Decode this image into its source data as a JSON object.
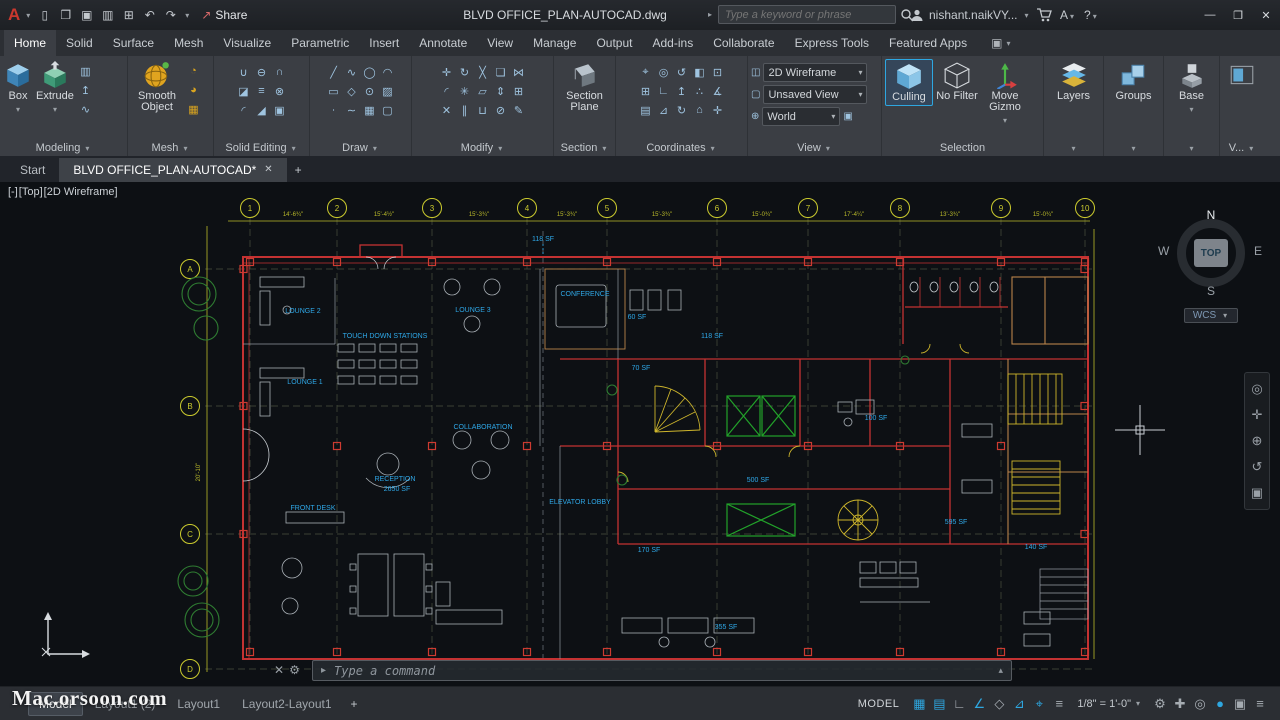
{
  "titlebar": {
    "logo": "A",
    "quick_icons": [
      {
        "name": "new-file",
        "glyph": "▯"
      },
      {
        "name": "open-file",
        "glyph": "❐"
      },
      {
        "name": "save",
        "glyph": "▣"
      },
      {
        "name": "save-as",
        "glyph": "▥"
      },
      {
        "name": "plot",
        "glyph": "⊞"
      },
      {
        "name": "undo",
        "glyph": "↶"
      },
      {
        "name": "redo",
        "glyph": "↷"
      }
    ],
    "share_label": "Share",
    "doc_title": "BLVD OFFICE_PLAN-AUTOCAD.dwg",
    "search_placeholder": "Type a keyword or phrase",
    "user_name": "nishant.naikVY...",
    "app_menu": "A",
    "help": "?"
  },
  "ribbon": {
    "tabs": [
      "Home",
      "Solid",
      "Surface",
      "Mesh",
      "Visualize",
      "Parametric",
      "Insert",
      "Annotate",
      "View",
      "Manage",
      "Output",
      "Add-ins",
      "Collaborate",
      "Express Tools",
      "Featured Apps"
    ],
    "panels": {
      "modeling": {
        "label": "Modeling",
        "box": "Box",
        "extrude": "Extrude",
        "icons": [
          {
            "name": "polysolid",
            "glyph": "▥"
          },
          {
            "name": "presspull",
            "glyph": "↥"
          },
          {
            "name": "sweep",
            "glyph": "∿"
          }
        ]
      },
      "mesh": {
        "label": "Mesh",
        "smooth_object": "Smooth Object",
        "icons": [
          {
            "name": "smooth-more",
            "glyph": "◔"
          },
          {
            "name": "smooth-less",
            "glyph": "◕"
          },
          {
            "name": "refine-mesh",
            "glyph": "▦"
          }
        ]
      },
      "solid_editing": {
        "label": "Solid Editing",
        "r1": [
          {
            "name": "union",
            "glyph": "∪"
          },
          {
            "name": "subtract",
            "glyph": "⊖"
          },
          {
            "name": "intersect",
            "glyph": "∩"
          }
        ],
        "r2": [
          {
            "name": "slice",
            "glyph": "◪"
          },
          {
            "name": "thicken",
            "glyph": "≡"
          },
          {
            "name": "interfere",
            "glyph": "⊗"
          }
        ],
        "r3": [
          {
            "name": "fillet-edge",
            "glyph": "◜"
          },
          {
            "name": "taper-face",
            "glyph": "◢"
          },
          {
            "name": "shell",
            "glyph": "▣"
          }
        ]
      },
      "draw": {
        "label": "Draw",
        "r1": [
          {
            "name": "line",
            "glyph": "╱"
          },
          {
            "name": "polyline",
            "glyph": "∿"
          },
          {
            "name": "circle",
            "glyph": "◯"
          },
          {
            "name": "arc",
            "glyph": "◠"
          }
        ],
        "r2": [
          {
            "name": "rectangle",
            "glyph": "▭"
          },
          {
            "name": "polygon",
            "glyph": "◇"
          },
          {
            "name": "ellipse",
            "glyph": "⊙"
          },
          {
            "name": "hatch",
            "glyph": "▨"
          }
        ],
        "r3": [
          {
            "name": "point",
            "glyph": "∙"
          },
          {
            "name": "spline",
            "glyph": "∼"
          },
          {
            "name": "gradient",
            "glyph": "▦"
          },
          {
            "name": "region",
            "glyph": "▢"
          }
        ]
      },
      "modify": {
        "label": "Modify",
        "r1": [
          {
            "name": "move",
            "glyph": "✛"
          },
          {
            "name": "rotate",
            "glyph": "↻"
          },
          {
            "name": "trim",
            "glyph": "╳"
          },
          {
            "name": "copy",
            "glyph": "❏"
          },
          {
            "name": "mirror",
            "glyph": "⋈"
          }
        ],
        "r2": [
          {
            "name": "fillet",
            "glyph": "◜"
          },
          {
            "name": "explode",
            "glyph": "✳"
          },
          {
            "name": "stretch",
            "glyph": "▱"
          },
          {
            "name": "scale",
            "glyph": "⇕"
          },
          {
            "name": "array",
            "glyph": "⊞"
          }
        ],
        "r3": [
          {
            "name": "erase",
            "glyph": "✕"
          },
          {
            "name": "offset",
            "glyph": "∥"
          },
          {
            "name": "join",
            "glyph": "⊔"
          },
          {
            "name": "measure",
            "glyph": "⊘"
          },
          {
            "name": "edit-polyline",
            "glyph": "✎"
          }
        ]
      },
      "section": {
        "label": "Section",
        "section_plane": "Section Plane"
      },
      "coordinates": {
        "label": "Coordinates",
        "r1": [
          {
            "name": "ucs",
            "glyph": "⌖"
          },
          {
            "name": "ucs-world",
            "glyph": "◎"
          },
          {
            "name": "ucs-previous",
            "glyph": "↺"
          },
          {
            "name": "ucs-face",
            "glyph": "◧"
          },
          {
            "name": "ucs-object",
            "glyph": "⊡"
          }
        ],
        "r2": [
          {
            "name": "ucs-view",
            "glyph": "⊞"
          },
          {
            "name": "ucs-origin",
            "glyph": "∟"
          },
          {
            "name": "ucs-z-axis",
            "glyph": "↥"
          },
          {
            "name": "ucs-3-point",
            "glyph": "∴"
          },
          {
            "name": "ucs-rotate-x",
            "glyph": "∡"
          }
        ],
        "r3": [
          {
            "name": "named-ucs",
            "glyph": "▤"
          },
          {
            "name": "ucs-rotate-y",
            "glyph": "⊿"
          },
          {
            "name": "ucs-rotate-z",
            "glyph": "↻"
          },
          {
            "name": "ucs-icon-properties",
            "glyph": "⌂"
          },
          {
            "name": "show-ucs-icon",
            "glyph": "✛"
          }
        ]
      },
      "view": {
        "label": "View",
        "visual_style": "2D Wireframe",
        "named_view": "Unsaved View",
        "ucs_name": "World"
      },
      "selection": {
        "label": "Selection",
        "culling": "Culling",
        "no_filter": "No Filter",
        "move_gizmo": "Move Gizmo"
      },
      "layers": {
        "label": "Layers"
      },
      "groups": {
        "label": "Groups"
      },
      "base": {
        "label": "Base"
      },
      "more": {
        "label": "V..."
      }
    }
  },
  "filetabs": {
    "start": "Start",
    "active_doc": "BLVD OFFICE_PLAN-AUTOCAD*"
  },
  "viewport": {
    "controls": {
      "minimize": "[-]",
      "view": "[Top]",
      "visual_style": "[2D Wireframe]"
    },
    "viewcube": {
      "north": "N",
      "south": "S",
      "east": "E",
      "west": "W",
      "top": "TOP",
      "wcs": "WCS"
    },
    "navbar": [
      {
        "name": "navigation-wheel",
        "glyph": "◎"
      },
      {
        "name": "pan",
        "glyph": "✛"
      },
      {
        "name": "zoom",
        "glyph": "⊕"
      },
      {
        "name": "orbit",
        "glyph": "↺"
      },
      {
        "name": "showmotion",
        "glyph": "▣"
      }
    ]
  },
  "drawing": {
    "labels": {
      "lounge1": "LOUNGE 1",
      "lounge2": "LOUNGE 2",
      "lounge3": "LOUNGE 3",
      "conference": "CONFERENCE",
      "touch_down": "TOUCH DOWN STATIONS",
      "collaboration": "COLLABORATION",
      "reception": "RECEPTION",
      "reception_area": "2650 SF",
      "front_desk": "FRONT DESK",
      "elevator_lobby": "ELEVATOR LOBBY",
      "sf_118_top": "118 SF",
      "sf_60": "60 SF",
      "sf_118": "118 SF",
      "sf_70": "70 SF",
      "sf_100": "100 SF",
      "sf_500": "500 SF",
      "sf_595": "595 SF",
      "sf_140": "140 SF",
      "sf_170": "170 SF",
      "sf_355": "355 SF"
    },
    "grid_top": [
      "1",
      "2",
      "3",
      "4",
      "5",
      "6",
      "7",
      "8",
      "9",
      "10"
    ],
    "grid_left": [
      "A",
      "B",
      "C",
      "D"
    ],
    "dims_top": [
      "14'-6¾\"",
      "15'-4½\"",
      "15'-3¾\"",
      "15'-3¾\"",
      "15'-3¾\"",
      "15'-0¾\"",
      "17'-4¼\"",
      "13'-3¾\"",
      "15'-0¾\""
    ],
    "dim_left": "20'-10\""
  },
  "command": {
    "placeholder": "Type a command"
  },
  "layout_tabs": [
    "Model",
    "Layout1 (2)",
    "Layout1",
    "Layout2-Layout1"
  ],
  "statusbar": {
    "model_label": "MODEL",
    "left_icons": [
      {
        "name": "grid-display",
        "glyph": "▦",
        "active": true
      },
      {
        "name": "snap-mode",
        "glyph": "▤",
        "active": true
      },
      {
        "name": "ortho-mode",
        "glyph": "∟"
      },
      {
        "name": "polar-tracking",
        "glyph": "∠",
        "active": true
      },
      {
        "name": "isometric-drafting",
        "glyph": "◇"
      },
      {
        "name": "object-snap-tracking",
        "glyph": "⊿",
        "active": true
      },
      {
        "name": "object-snap",
        "glyph": "⌖",
        "active": true
      },
      {
        "name": "lineweight",
        "glyph": "≡"
      }
    ],
    "scale": "1/8\" = 1'-0\"",
    "right_icons": [
      {
        "name": "workspace-switching",
        "glyph": "⚙"
      },
      {
        "name": "annotation-monitor",
        "glyph": "✚"
      },
      {
        "name": "isolate-objects",
        "glyph": "◎"
      },
      {
        "name": "graphics-performance",
        "glyph": "●",
        "active": true
      },
      {
        "name": "clean-screen",
        "glyph": "▣"
      },
      {
        "name": "customize",
        "glyph": "≡"
      }
    ]
  },
  "watermark": "Mac.orsoon.com"
}
